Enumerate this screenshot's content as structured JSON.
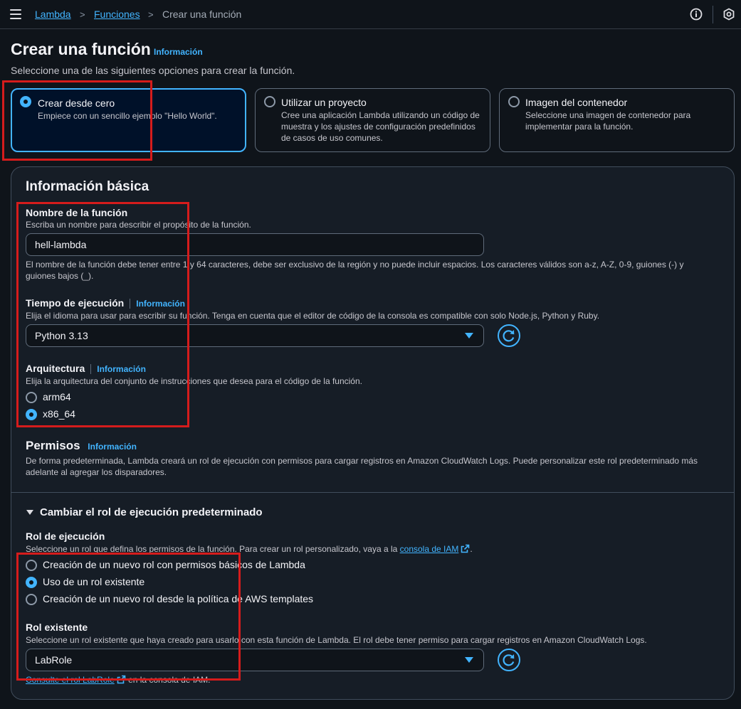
{
  "breadcrumb": {
    "items": [
      "Lambda",
      "Funciones"
    ],
    "current": "Crear una función",
    "separator": ">"
  },
  "header": {
    "title": "Crear una función",
    "info_link": "Información",
    "subtitle": "Seleccione una de las siguientes opciones para crear la función."
  },
  "creation_options": [
    {
      "title": "Crear desde cero",
      "description": "Empiece con un sencillo ejemplo \"Hello World\".",
      "selected": true
    },
    {
      "title": "Utilizar un proyecto",
      "description": "Cree una aplicación Lambda utilizando un código de muestra y los ajustes de configuración predefinidos de casos de uso comunes.",
      "selected": false
    },
    {
      "title": "Imagen del contenedor",
      "description": "Seleccione una imagen de contenedor para implementar para la función.",
      "selected": false
    }
  ],
  "basic_info": {
    "title": "Información básica",
    "function_name": {
      "label": "Nombre de la función",
      "description": "Escriba un nombre para describir el propósito de la función.",
      "value": "hell-lambda",
      "constraint": "El nombre de la función debe tener entre 1 y 64 caracteres, debe ser exclusivo de la región y no puede incluir espacios. Los caracteres válidos son a-z, A-Z, 0-9, guiones (-) y guiones bajos (_)."
    },
    "runtime": {
      "label": "Tiempo de ejecución",
      "info_link": "Información",
      "description": "Elija el idioma para usar para escribir su función. Tenga en cuenta que el editor de código de la consola es compatible con solo Node.js, Python y Ruby.",
      "value": "Python 3.13"
    },
    "architecture": {
      "label": "Arquitectura",
      "info_link": "Información",
      "description": "Elija la arquitectura del conjunto de instrucciones que desea para el código de la función.",
      "options": [
        {
          "label": "arm64",
          "selected": false
        },
        {
          "label": "x86_64",
          "selected": true
        }
      ]
    },
    "permissions": {
      "title": "Permisos",
      "info_link": "Información",
      "description": "De forma predeterminada, Lambda creará un rol de ejecución con permisos para cargar registros en Amazon CloudWatch Logs. Puede personalizar este rol predeterminado más adelante al agregar los disparadores."
    }
  },
  "role_section": {
    "expander_label": "Cambiar el rol de ejecución predeterminado",
    "execution_role": {
      "label": "Rol de ejecución",
      "description_prefix": "Seleccione un rol que defina los permisos de la función. Para crear un rol personalizado, vaya a la ",
      "iam_link": "consola de IAM",
      "description_suffix": ".",
      "options": [
        {
          "label": "Creación de un nuevo rol con permisos básicos de Lambda",
          "selected": false
        },
        {
          "label": "Uso de un rol existente",
          "selected": true
        },
        {
          "label": "Creación de un nuevo rol desde la política de AWS templates",
          "selected": false
        }
      ]
    },
    "existing_role": {
      "label": "Rol existente",
      "description": "Seleccione un rol existente que haya creado para usarlo con esta función de Lambda. El rol debe tener permiso para cargar registros en Amazon CloudWatch Logs.",
      "value": "LabRole",
      "footer_link": "Consulte el rol LabRole",
      "footer_suffix": " en la consola de IAM."
    }
  },
  "colors": {
    "background": "#0f141a",
    "panel": "#161d26",
    "accent": "#42b4ff",
    "annotation_red": "#d51c1c"
  }
}
